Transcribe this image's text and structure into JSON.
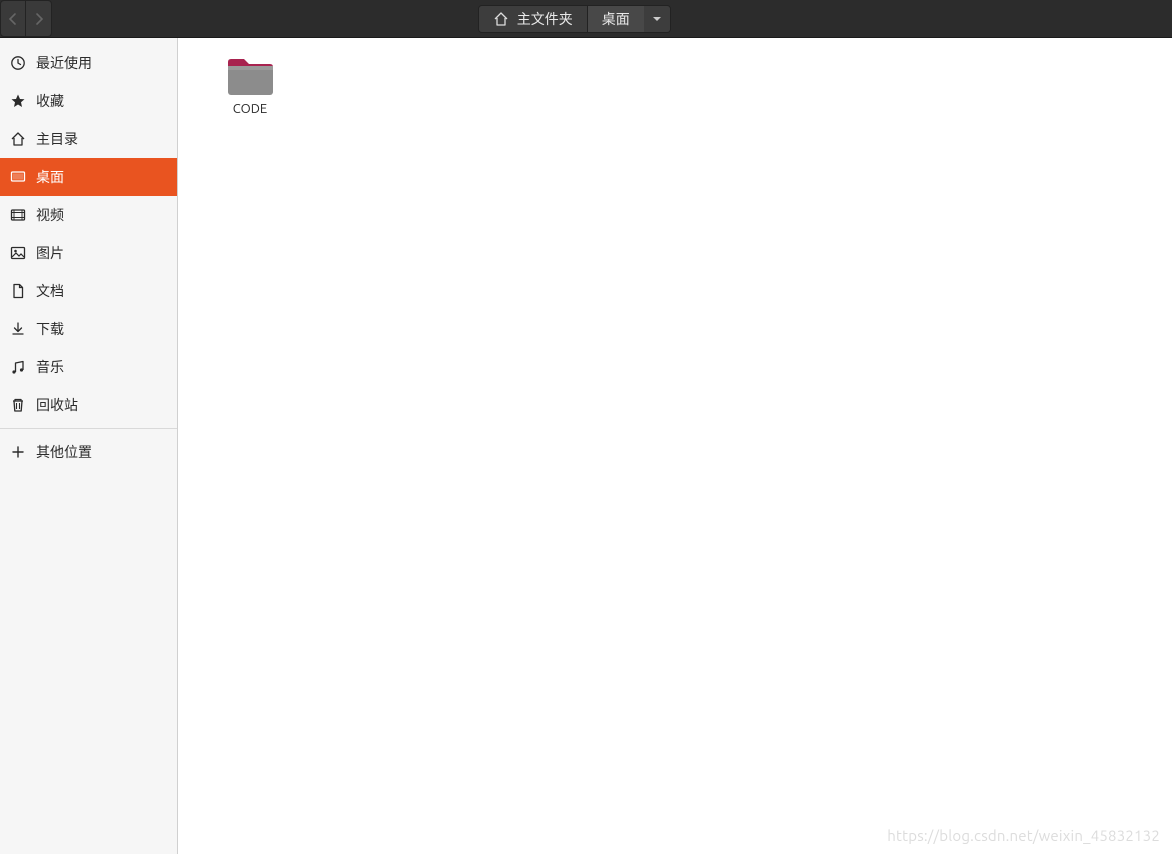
{
  "topbar": {
    "nav": {
      "back_enabled": false,
      "forward_enabled": false
    },
    "path": [
      {
        "label": "主文件夹",
        "is_home": true
      },
      {
        "label": "桌面",
        "is_current": true
      }
    ]
  },
  "sidebar": {
    "items": [
      {
        "icon": "clock",
        "label": "最近使用",
        "active": false
      },
      {
        "icon": "star",
        "label": "收藏",
        "active": false
      },
      {
        "icon": "home",
        "label": "主目录",
        "active": false
      },
      {
        "icon": "desktop",
        "label": "桌面",
        "active": true
      },
      {
        "icon": "video",
        "label": "视频",
        "active": false
      },
      {
        "icon": "image",
        "label": "图片",
        "active": false
      },
      {
        "icon": "doc",
        "label": "文档",
        "active": false
      },
      {
        "icon": "download",
        "label": "下载",
        "active": false
      },
      {
        "icon": "music",
        "label": "音乐",
        "active": false
      },
      {
        "icon": "trash",
        "label": "回收站",
        "active": false
      }
    ],
    "other": {
      "icon": "plus",
      "label": "其他位置"
    }
  },
  "files": [
    {
      "type": "folder",
      "name": "CODE"
    }
  ],
  "watermark": "https://blog.csdn.net/weixin_45832132",
  "colors": {
    "accent": "#e95420"
  }
}
